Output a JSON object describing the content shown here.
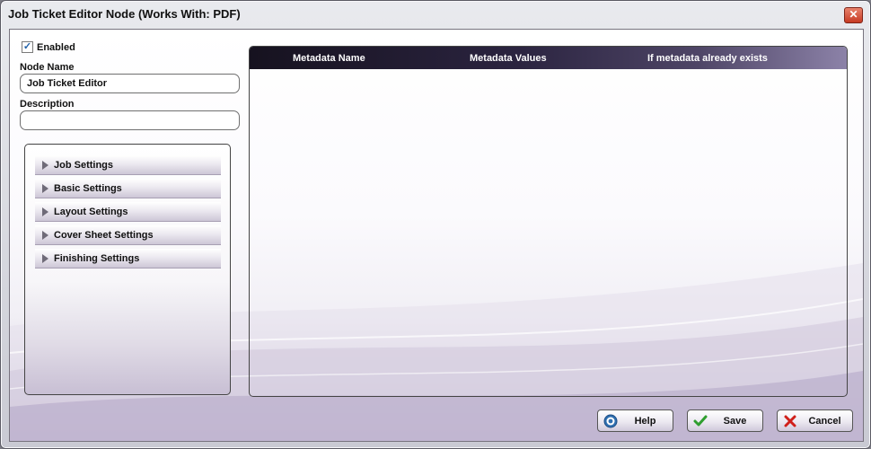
{
  "window": {
    "title": "Job Ticket Editor Node (Works With: PDF)",
    "close_glyph": "✕"
  },
  "form": {
    "enabled_label": "Enabled",
    "enabled_checked": true,
    "check_glyph": "✓",
    "node_name_label": "Node Name",
    "node_name_value": "Job Ticket Editor",
    "description_label": "Description",
    "description_value": ""
  },
  "sections": [
    {
      "label": "Job Settings",
      "icon": "triangle-right-icon"
    },
    {
      "label": "Basic Settings",
      "icon": "triangle-right-icon"
    },
    {
      "label": "Layout Settings",
      "icon": "triangle-right-icon"
    },
    {
      "label": "Cover Sheet Settings",
      "icon": "triangle-right-icon"
    },
    {
      "label": "Finishing Settings",
      "icon": "triangle-right-icon"
    }
  ],
  "metadata_table": {
    "columns": [
      "Metadata Name",
      "Metadata Values",
      "If metadata already exists"
    ],
    "rows": []
  },
  "buttons": {
    "help": {
      "label": "Help",
      "icon": "help-icon"
    },
    "save": {
      "label": "Save",
      "icon": "checkmark-icon"
    },
    "cancel": {
      "label": "Cancel",
      "icon": "cross-icon"
    }
  },
  "colors": {
    "accent": "#2b2440",
    "close": "#c63a23",
    "save_check": "#2f9e2f",
    "cancel_cross": "#d0201a",
    "help_blue": "#2f6fb0"
  }
}
